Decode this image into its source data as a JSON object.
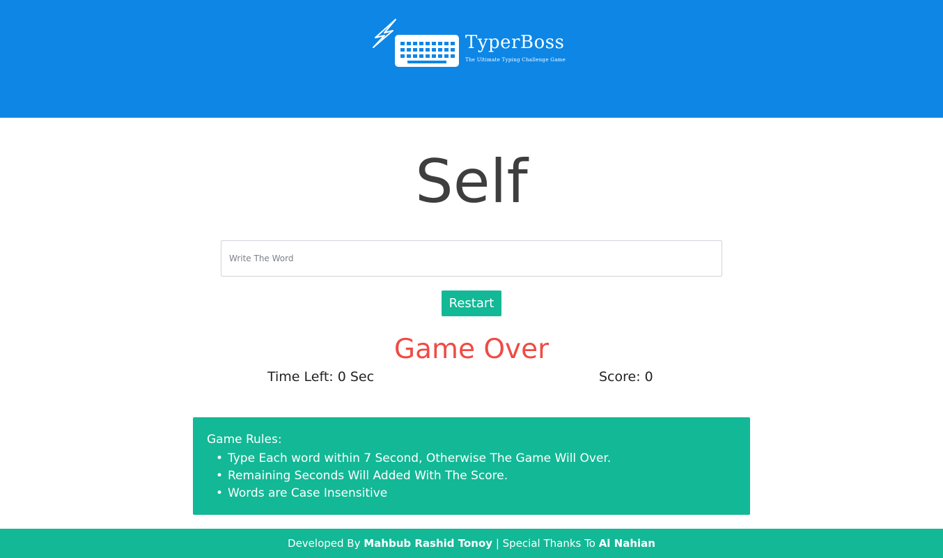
{
  "header": {
    "logo_title": "TyperBoss",
    "logo_subtitle": "The Ultimate Typing Challenge Game"
  },
  "game": {
    "current_word": "Self",
    "input_placeholder": "Write The Word",
    "input_value": "",
    "restart_label": "Restart",
    "status_message": "Game Over",
    "time_left_label": "Time Left:",
    "time_left_value": "0",
    "time_left_unit": "Sec",
    "score_label": "Score:",
    "score_value": "0"
  },
  "rules": {
    "title": "Game Rules:",
    "items": [
      {
        "bullet": "•",
        "text": "Type Each word within 7 Second, Otherwise The Game Will Over."
      },
      {
        "bullet": "•",
        "text": "Remaining Seconds Will Added With The Score."
      },
      {
        "bullet": "•",
        "text": "Words are Case Insensitive"
      }
    ]
  },
  "footer": {
    "developed_by_label": "Developed By",
    "developer_name": "Mahbub Rashid Tonoy",
    "separator": "|",
    "thanks_label": "Special Thanks To",
    "thanks_name": "Al Nahian"
  },
  "colors": {
    "header_bg": "#0d86e6",
    "accent_green": "#13b896",
    "game_over_red": "#ef4b44"
  },
  "icons": {
    "logo_bolt": "lightning-bolt-icon",
    "logo_keyboard": "keyboard-icon"
  }
}
